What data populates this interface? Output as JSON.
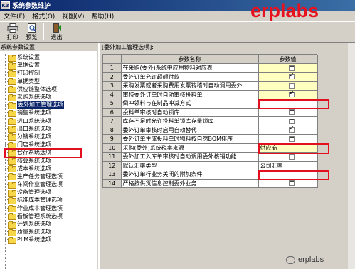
{
  "window": {
    "icon_text": "K3",
    "title": "系统参数维护"
  },
  "menu": [
    {
      "label": "文件(F)"
    },
    {
      "label": "格式(O)"
    },
    {
      "label": "视图(V)"
    },
    {
      "label": "帮助(H)"
    }
  ],
  "toolbar": {
    "print_label": "打印",
    "preview_label": "预览",
    "exit_label": "退出"
  },
  "watermark": {
    "logo": "erplabs",
    "footer": "erplabs"
  },
  "left_panel": {
    "header": "系统参数设置",
    "items": [
      {
        "label": "系统设置"
      },
      {
        "label": "单据设置"
      },
      {
        "label": "打印控制"
      },
      {
        "label": "单据类型"
      },
      {
        "label": "供应链整体选项"
      },
      {
        "label": "采购系统选项"
      },
      {
        "label": "委外加工管理选项",
        "selected": true
      },
      {
        "label": "销售系统选项"
      },
      {
        "label": "进口系统选项"
      },
      {
        "label": "出口系统选项"
      },
      {
        "label": "分销系统选项"
      },
      {
        "label": "门店系统选项"
      },
      {
        "label": "仓存系统选项"
      },
      {
        "label": "核算系统选项"
      },
      {
        "label": "成本系统选项"
      },
      {
        "label": "生产任务管理选项"
      },
      {
        "label": "车间作业管理选项"
      },
      {
        "label": "设备管理选项"
      },
      {
        "label": "标准成本管理选项"
      },
      {
        "label": "作业成本管理选项"
      },
      {
        "label": "看板管理系统选项"
      },
      {
        "label": "计划系统选项"
      },
      {
        "label": "质量系统选项"
      },
      {
        "label": "PLM系统选项"
      }
    ]
  },
  "right_panel": {
    "title": "[委外加工管理选项]:",
    "col_name": "参数名称",
    "col_value": "参数值",
    "rows": [
      {
        "num": "1",
        "name": "在采购(委外)系统中应用物料对应表",
        "type": "checkbox",
        "checked": false,
        "yellow": true
      },
      {
        "num": "2",
        "name": "委外订单允许超额付款",
        "type": "checkbox",
        "checked": true,
        "yellow": true
      },
      {
        "num": "3",
        "name": "采购发票或者采购费用发票钩稽时自动调用委外",
        "type": "checkbox",
        "checked": false,
        "yellow": true
      },
      {
        "num": "4",
        "name": "审核委外订单时自动审核投料单",
        "type": "checkbox",
        "checked": true,
        "yellow": true
      },
      {
        "num": "5",
        "name": "倒冲领料与在制品冲减方式",
        "type": "text",
        "value": "",
        "yellow": false,
        "highlight": true
      },
      {
        "num": "6",
        "name": "投料单审核时自动锁库",
        "type": "checkbox",
        "checked": false,
        "yellow": false
      },
      {
        "num": "7",
        "name": "库存不足时允许投料单锁库存量锁库",
        "type": "checkbox",
        "checked": false,
        "yellow": false
      },
      {
        "num": "8",
        "name": "委外订单审核时启用自动替代",
        "type": "checkbox",
        "checked": true,
        "yellow": false
      },
      {
        "num": "9",
        "name": "委外订单生成投料单时物料按自然BOM排序",
        "type": "checkbox",
        "checked": false,
        "yellow": false
      },
      {
        "num": "10",
        "name": "采购(委外)系统税率来源",
        "type": "text",
        "value": "供应商",
        "yellow": true,
        "highlight": true
      },
      {
        "num": "11",
        "name": "委外加工入库单审核时自动调用委外核销功能",
        "type": "checkbox",
        "checked": false,
        "yellow": false
      },
      {
        "num": "12",
        "name": "默认汇率类型",
        "type": "text",
        "value": "公司汇率",
        "yellow": false
      },
      {
        "num": "13",
        "name": "委外订单行业务关闭的附加条件",
        "type": "text",
        "value": "",
        "yellow": false,
        "highlight": true
      },
      {
        "num": "14",
        "name": "严格按供货信息控制委外业务",
        "type": "checkbox",
        "checked": false,
        "yellow": false
      }
    ]
  },
  "colors": {
    "title_bar": "#0a246a",
    "selection": "#0a246a",
    "highlight_border": "#e0101e",
    "yellow_cell": "#ffffc0",
    "logo": "#e8121e"
  }
}
